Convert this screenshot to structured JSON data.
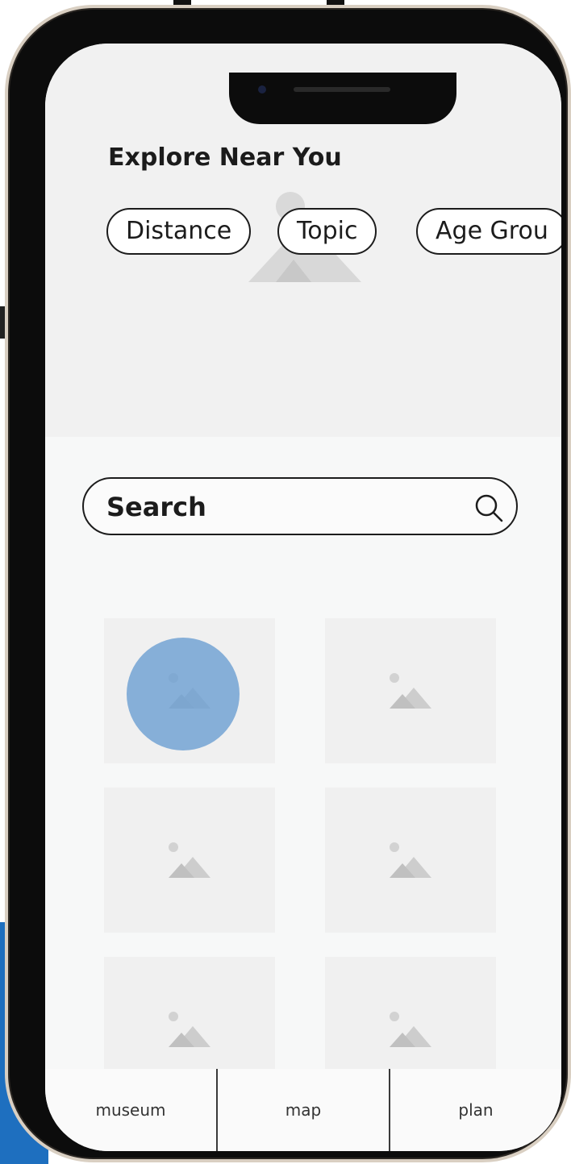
{
  "header": {
    "title": "Explore Near You",
    "filters": [
      "Distance",
      "Topic",
      "Age Grou"
    ]
  },
  "search": {
    "label": "Search",
    "icon": "search-icon"
  },
  "grid": {
    "items": [
      {
        "icon": "image-placeholder-icon"
      },
      {
        "icon": "image-placeholder-icon"
      },
      {
        "icon": "image-placeholder-icon"
      },
      {
        "icon": "image-placeholder-icon"
      },
      {
        "icon": "image-placeholder-icon"
      },
      {
        "icon": "image-placeholder-icon"
      }
    ]
  },
  "bottom_nav": {
    "items": [
      "museum",
      "map",
      "plan"
    ]
  },
  "colors": {
    "touch_indicator": "#6ea0d2",
    "background_accent": "#1e6fbf"
  }
}
